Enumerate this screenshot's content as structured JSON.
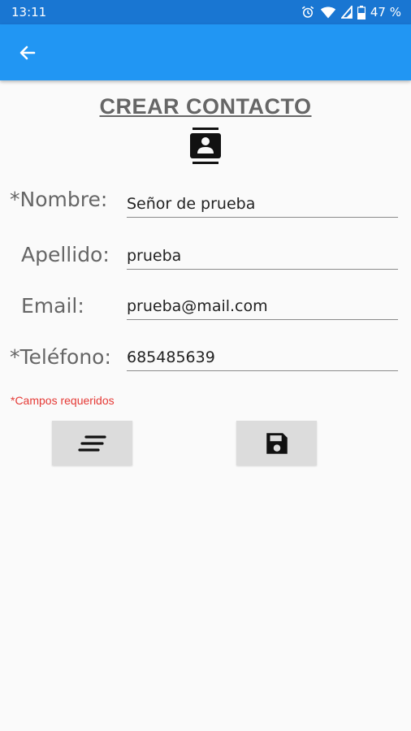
{
  "status_bar": {
    "time": "13:11",
    "battery": "47 %",
    "icons": [
      "alarm-icon",
      "wifi-icon",
      "signal-icon",
      "battery-icon"
    ]
  },
  "app_bar": {
    "back_icon": "arrow-back-icon",
    "color": "#2196f3"
  },
  "form": {
    "title": "CREAR CONTACTO",
    "header_icon": "contact-card-icon",
    "fields": {
      "nombre": {
        "label": "*Nombre:",
        "value": "Señor de prueba"
      },
      "apellido": {
        "label": "Apellido:",
        "value": "prueba"
      },
      "email": {
        "label": "Email:",
        "value": "prueba@mail.com"
      },
      "telefono": {
        "label": "*Teléfono:",
        "value": "685485639"
      }
    },
    "required_note": "*Campos requeridos",
    "buttons": {
      "list_icon": "list-icon",
      "save_icon": "save-floppy-icon"
    }
  }
}
